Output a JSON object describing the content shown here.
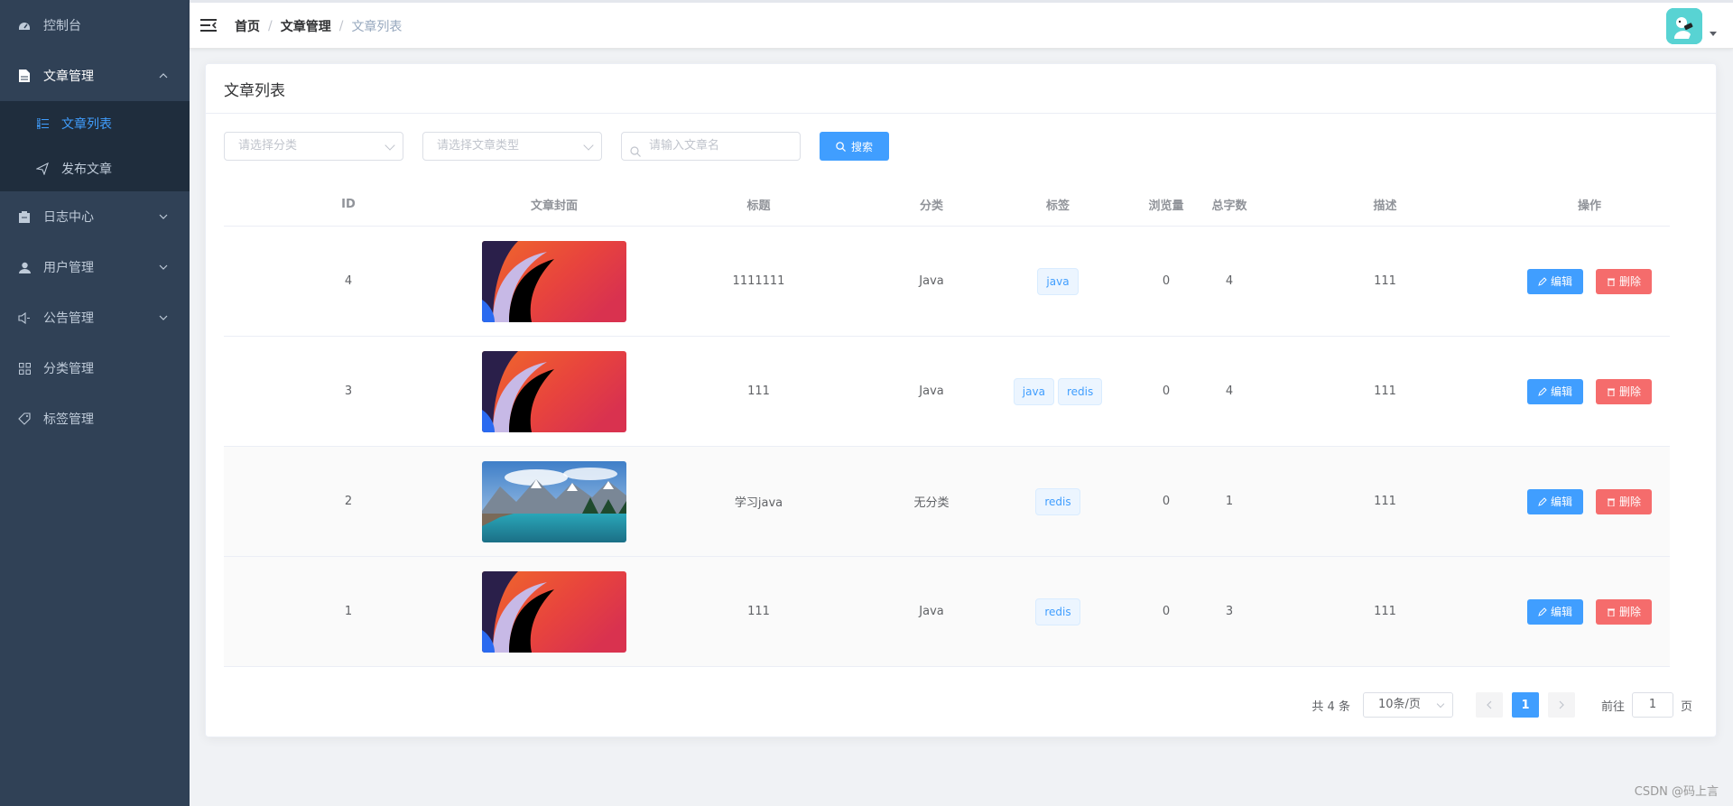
{
  "sidebar": {
    "items": [
      {
        "label": "控制台",
        "icon": "dashboard-icon"
      },
      {
        "label": "文章管理",
        "icon": "document-icon"
      },
      {
        "label": "日志中心",
        "icon": "log-icon"
      },
      {
        "label": "用户管理",
        "icon": "user-icon"
      },
      {
        "label": "公告管理",
        "icon": "speaker-icon"
      },
      {
        "label": "分类管理",
        "icon": "grid-icon"
      },
      {
        "label": "标签管理",
        "icon": "tag-icon"
      }
    ],
    "submenu": [
      {
        "label": "文章列表",
        "icon": "list-icon"
      },
      {
        "label": "发布文章",
        "icon": "send-icon"
      }
    ]
  },
  "navbar": {
    "breadcrumb": [
      "首页",
      "文章管理",
      "文章列表"
    ]
  },
  "card": {
    "title": "文章列表"
  },
  "filters": {
    "category_placeholder": "请选择分类",
    "type_placeholder": "请选择文章类型",
    "search_placeholder": "请输入文章名",
    "search_label": "搜索"
  },
  "table": {
    "headers": [
      "ID",
      "文章封面",
      "标题",
      "分类",
      "标签",
      "浏览量",
      "总字数",
      "描述",
      "操作"
    ],
    "rows": [
      {
        "id": "4",
        "title": "1111111",
        "category": "Java",
        "tags": [
          "java"
        ],
        "views": "0",
        "words": "4",
        "desc": "111",
        "cover": "abstract-red"
      },
      {
        "id": "3",
        "title": "111",
        "category": "Java",
        "tags": [
          "java",
          "redis"
        ],
        "views": "0",
        "words": "4",
        "desc": "111",
        "cover": "abstract-red"
      },
      {
        "id": "2",
        "title": "学习java",
        "category": "无分类",
        "tags": [
          "redis"
        ],
        "views": "0",
        "words": "1",
        "desc": "111",
        "cover": "mountain-lake"
      },
      {
        "id": "1",
        "title": "111",
        "category": "Java",
        "tags": [
          "redis"
        ],
        "views": "0",
        "words": "3",
        "desc": "111",
        "cover": "abstract-red"
      }
    ],
    "edit_label": "编辑",
    "delete_label": "删除"
  },
  "pagination": {
    "total": "共 4 条",
    "page_size": "10条/页",
    "current": "1",
    "goto_prefix": "前往",
    "goto_value": "1",
    "goto_suffix": "页"
  },
  "watermark": "CSDN @码上言",
  "colors": {
    "sidebar_bg": "#304156",
    "primary": "#409eff",
    "danger": "#f56c6c"
  }
}
